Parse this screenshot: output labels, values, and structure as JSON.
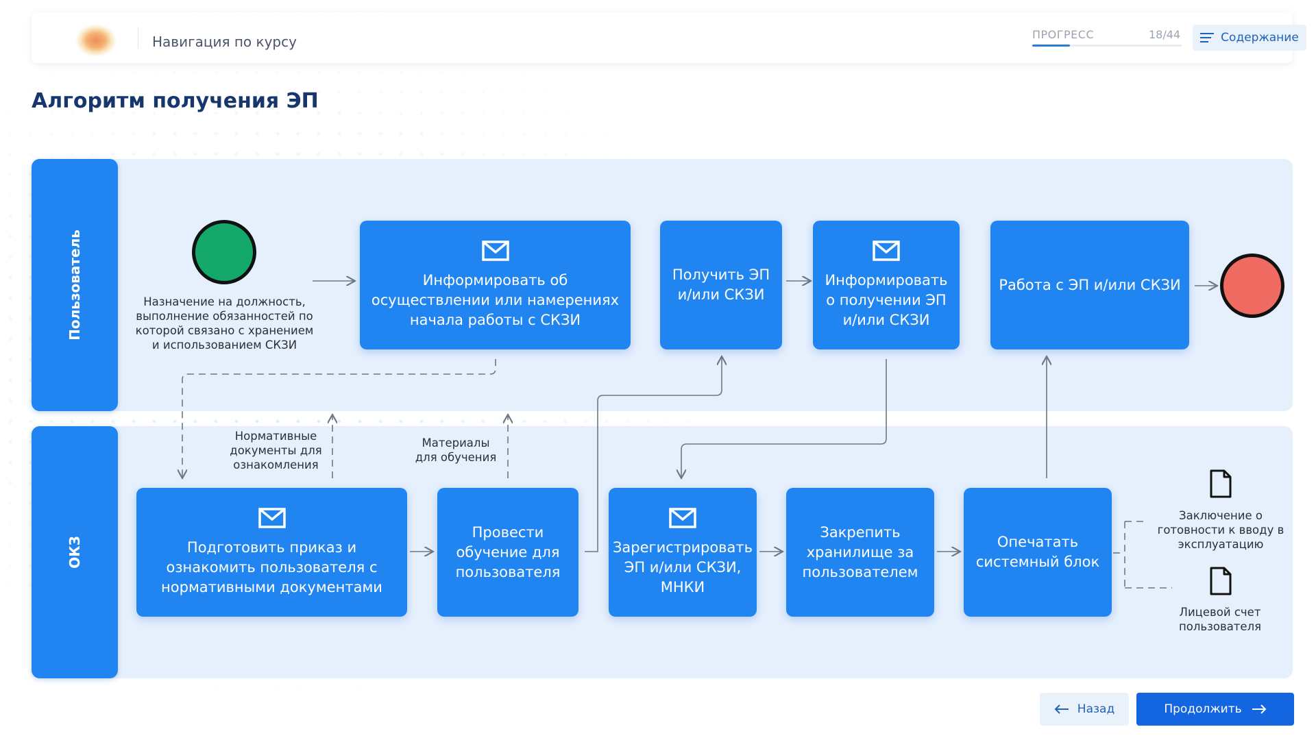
{
  "header": {
    "nav_title": "Навигация по курсу",
    "progress_label": "ПРОГРЕСС",
    "progress_count": "18/44",
    "progress_fraction": 0.25,
    "toc_label": "Содержание"
  },
  "page_title": "Алгоритм получения ЭП",
  "lanes": {
    "user": "Пользователь",
    "okz": "ОКЗ"
  },
  "start_note": "Назначение на должность, выполнение обязанностей по которой связано с хранением и использованием СКЗИ",
  "boxes": {
    "inform_start": "Информировать об осуществлении или намерениях начала работы с СКЗИ",
    "get_ep": "Получить ЭП и/или СКЗИ",
    "inform_receipt": "Информировать о получении ЭП и/или СКЗИ",
    "work_ep": "Работа с ЭП и/или СКЗИ",
    "prepare_order": "Подготовить приказ и ознакомить пользователя с нормативными документами",
    "training": "Провести обучение для пользователя",
    "register": "Зарегистрировать ЭП и/или СКЗИ, МНКИ",
    "assign_storage": "Закрепить хранилище за пользователем",
    "print_unit": "Опечатать системный блок"
  },
  "notes": {
    "normative_docs": "Нормативные документы для ознакомления",
    "training_materials": "Материалы для обучения"
  },
  "documents": {
    "readiness": "Заключение о готовности к вводу в эксплуатацию",
    "account": "Лицевой счет пользователя"
  },
  "footer": {
    "back_label": "Назад",
    "next_label": "Продолжить"
  },
  "colors": {
    "start": "#15a86b",
    "end": "#ef6b61",
    "box": "#2185f1",
    "lane": "#e6f0fd",
    "primary_button": "#1466e0"
  }
}
